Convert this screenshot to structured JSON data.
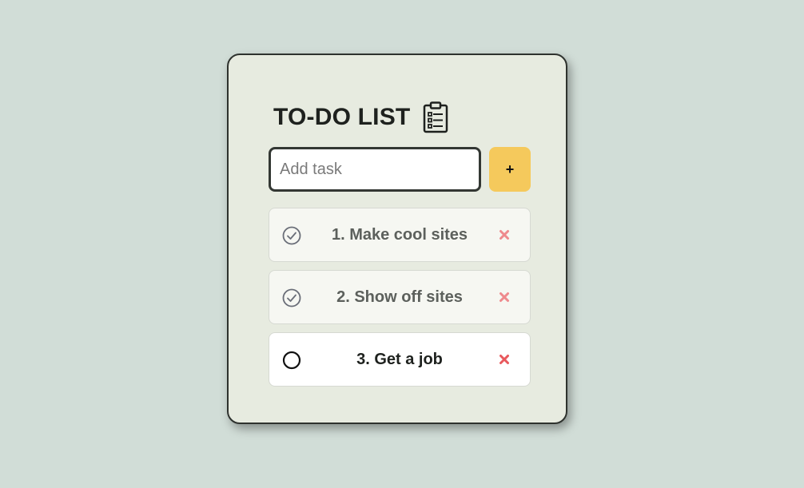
{
  "app": {
    "title": "TO-DO LIST",
    "icon": "clipboard-list-icon"
  },
  "input": {
    "value": "",
    "placeholder": "Add task"
  },
  "add_button": {
    "label": "+"
  },
  "tasks": [
    {
      "label": "1. Make cool sites",
      "done": true
    },
    {
      "label": "2. Show off sites",
      "done": true
    },
    {
      "label": "3. Get a job",
      "done": false
    }
  ],
  "colors": {
    "background": "#d1ddd7",
    "card": "#e7ebe0",
    "accent": "#f5c95c",
    "delete": "#e8585c"
  }
}
